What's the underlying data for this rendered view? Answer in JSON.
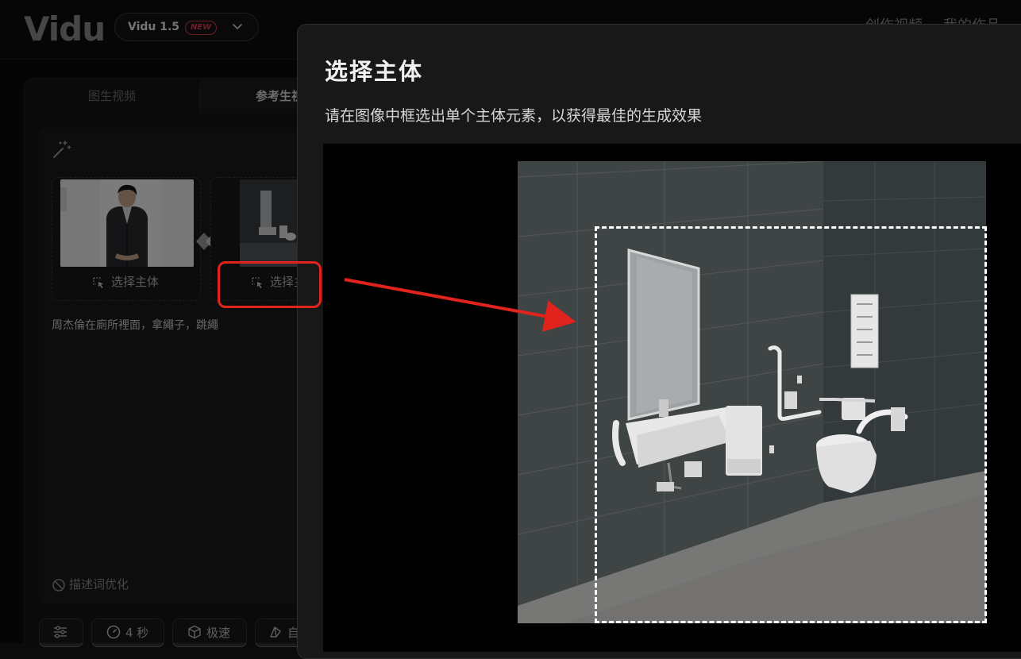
{
  "header": {
    "logo": "Vidu",
    "model": {
      "name": "Vidu 1.5",
      "badge": "NEW"
    },
    "nav": [
      "创作视频",
      "我的作品"
    ]
  },
  "panel": {
    "tabs": [
      "图生视频",
      "参考生视频"
    ],
    "reference_slots": [
      {
        "action_label": "选择主体"
      },
      {
        "action_label": "选择主体"
      }
    ],
    "prompt_text": "周杰倫在廁所裡面，拿繩子，跳繩",
    "optimize_label": "描述词优化",
    "chips": {
      "duration": "4 秒",
      "speed": "极速",
      "style": "自"
    }
  },
  "modal": {
    "title": "选择主体",
    "description": "请在图像中框选出单个主体元素，以获得最佳的生成效果"
  },
  "colors": {
    "highlight": "#e1231d",
    "badge": "#e2394d",
    "selection_border": "#ffffff"
  }
}
